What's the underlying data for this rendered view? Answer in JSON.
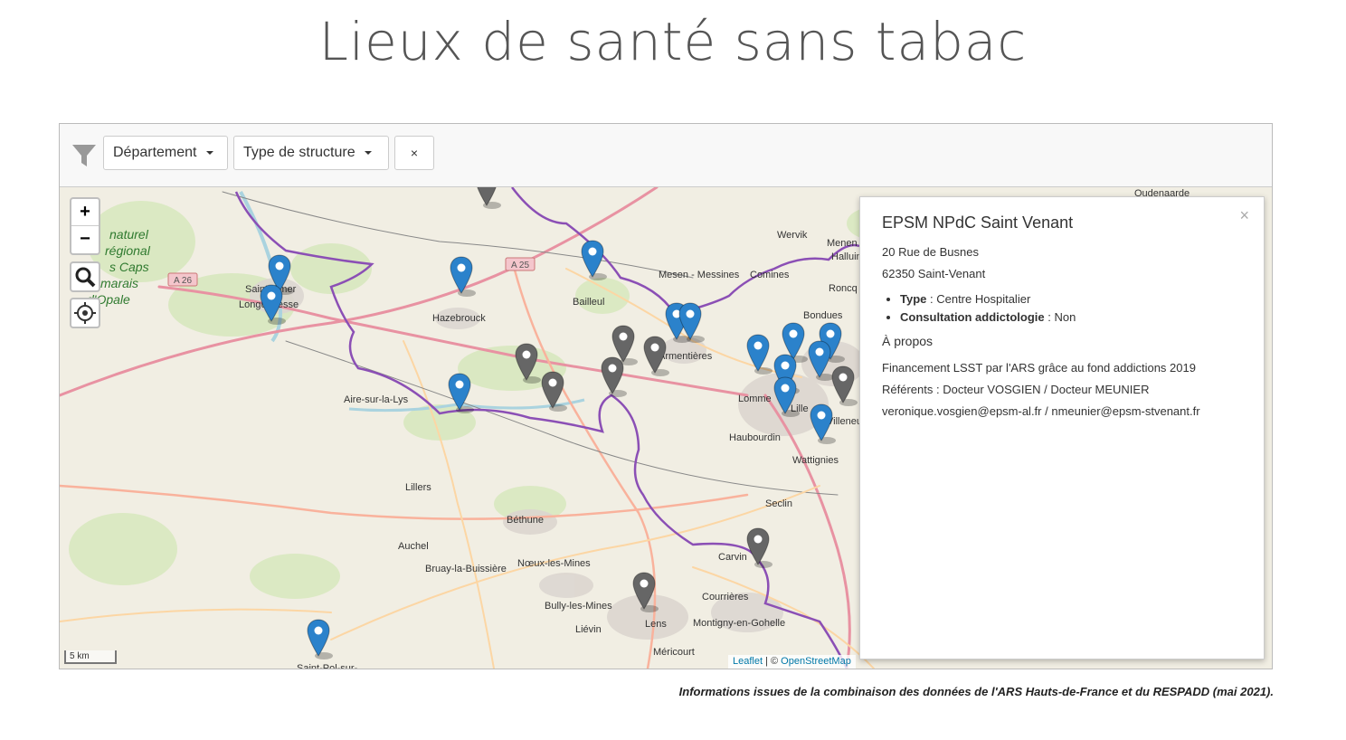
{
  "page": {
    "title": "Lieux de santé sans tabac",
    "footer_note": "Informations issues de la combinaison des données de l'ARS Hauts-de-France et du RESPADD (mai 2021)."
  },
  "toolbar": {
    "filter_icon": "funnel-icon",
    "department_label": "Département",
    "structure_label": "Type de structure",
    "clear_label": "×"
  },
  "map": {
    "zoom_in": "+",
    "zoom_out": "−",
    "search_icon": "magnifier-icon",
    "locate_icon": "crosshair-icon",
    "scale_label": "5 km",
    "attribution_leaflet": "Leaflet",
    "attribution_sep": " | © ",
    "attribution_osm": "OpenStreetMap",
    "park_label": [
      "naturel",
      "régional",
      "s Caps",
      "marais",
      "d'Opale"
    ],
    "road_labels": [
      "A 26",
      "A 25"
    ],
    "towns": [
      "Oudenaarde",
      "Menen",
      "Halluin",
      "Wervik",
      "Comines",
      "Mesen - Messines",
      "Bailleul",
      "Hazebrouck",
      "Saint-Omer",
      "Longuenesse",
      "Armentières",
      "Bondues",
      "Roncq",
      "Lomme",
      "Lille",
      "Villeneuve-d'Ascq",
      "Haubourdin",
      "Wattignies",
      "Seclin",
      "Aire-sur-la-Lys",
      "Lillers",
      "Béthune",
      "Auchel",
      "Bruay-la-Buissière",
      "Nœux-les-Mines",
      "Bully-les-Mines",
      "Liévin",
      "Lens",
      "Méricourt",
      "Montigny-en-Gohelle",
      "Courrières",
      "Carvin",
      "Saint-Pol-sur-"
    ],
    "marker_colors": {
      "blue": "#2b82cb",
      "gray": "#666666",
      "green": "#7db33a"
    }
  },
  "popup": {
    "title": "EPSM NPdC Saint Venant",
    "close": "×",
    "address_line1": "20 Rue de Busnes",
    "address_line2": "62350 Saint-Venant",
    "type_label": "Type",
    "type_value": " : Centre Hospitalier",
    "consult_label": "Consultation addictologie",
    "consult_value": " : Non",
    "about_label": "À propos",
    "about_line1": "Financement LSST par l'ARS grâce au fond addictions 2019",
    "about_line2": "Référents : Docteur VOSGIEN / Docteur MEUNIER",
    "about_line3": "veronique.vosgien@epsm-al.fr / nmeunier@epsm-stvenant.fr"
  }
}
